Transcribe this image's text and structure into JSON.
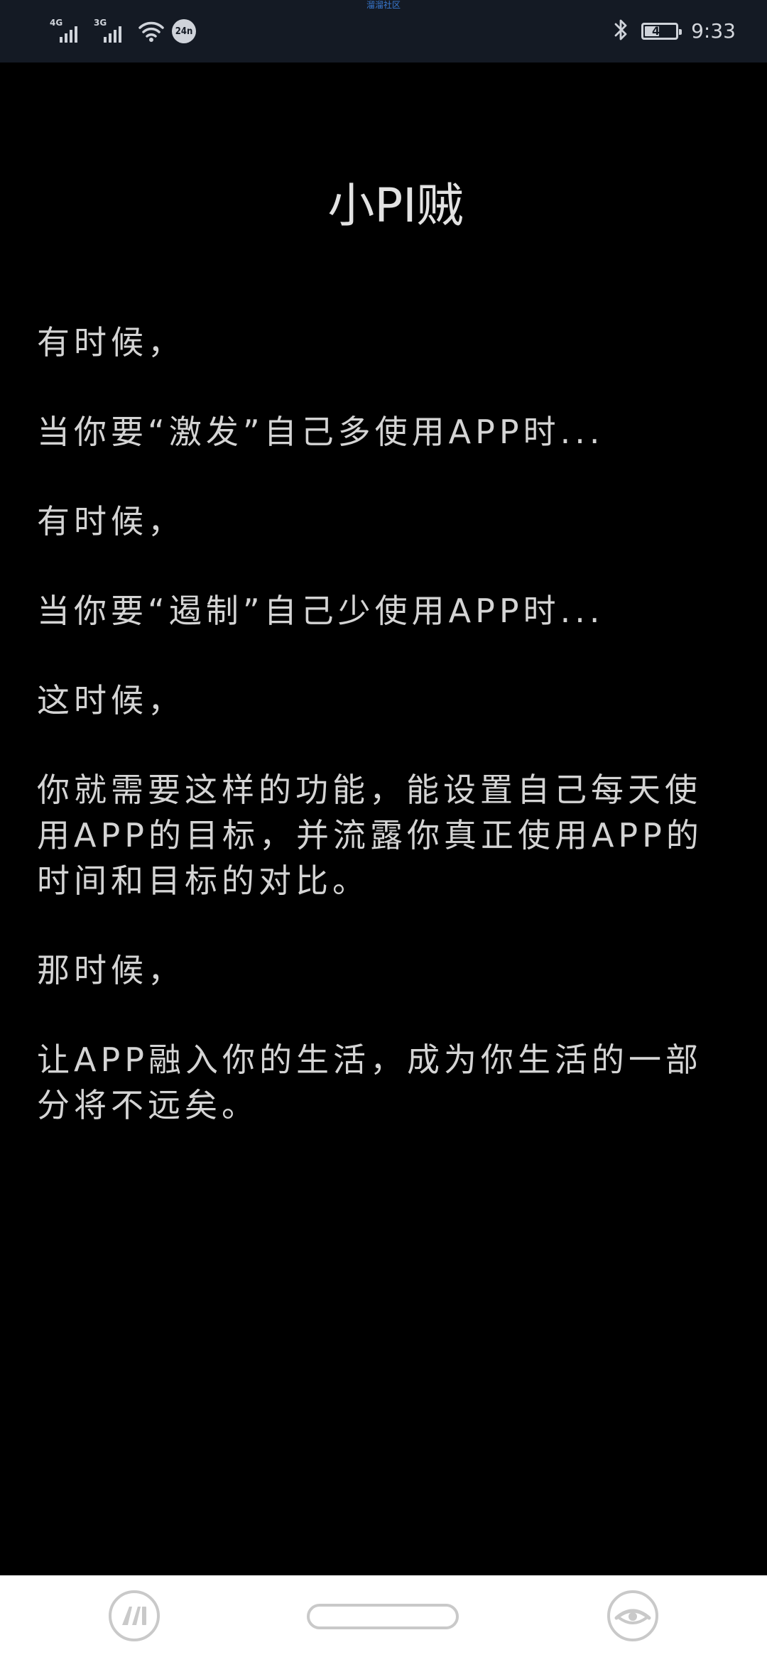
{
  "status_bar": {
    "top_label": "溜溜社区",
    "network_1": "4G",
    "network_2": "3G",
    "speed_badge": "24n",
    "battery_level": "46",
    "battery_fraction": 0.46,
    "time": "9:33",
    "icons": [
      "signal-icon",
      "signal-icon",
      "wifi-icon",
      "bluetooth-icon",
      "battery-icon"
    ]
  },
  "page": {
    "title": "小PI贼",
    "paragraphs": [
      "有时候，",
      "当你要“激发”自己多使用APP时...",
      "有时候，",
      "当你要“遏制”自己少使用APP时...",
      "这时候，",
      "你就需要这样的功能，能设置自己每天使用APP的目标，并流露你真正使用APP的时间和目标的对比。",
      "那时候，",
      "让APP融入你的生活，成为你生活的一部分将不远矣。"
    ]
  },
  "nav_bar": {
    "icons": [
      "ai-assistant-icon",
      "home-pill",
      "eye-icon"
    ]
  },
  "colors": {
    "background": "#000000",
    "status_bar": "#141a24",
    "text": "#d4d4d4",
    "nav_bar": "#ffffff"
  }
}
